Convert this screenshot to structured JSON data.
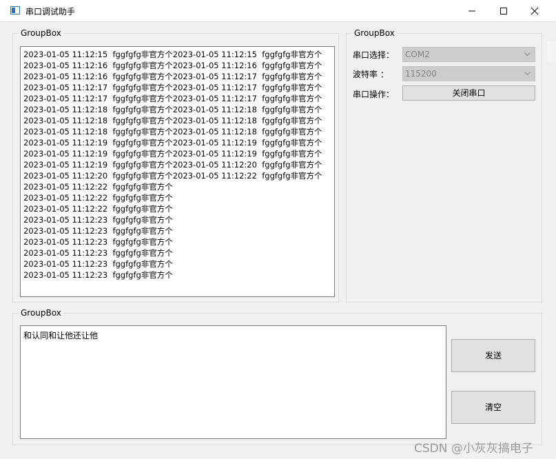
{
  "window": {
    "title": "串口调试助手"
  },
  "log_group": {
    "title": "GroupBox",
    "lines": [
      "2023-01-05 11:12:15  fggfgfg非官方个2023-01-05 11:12:15  fggfgfg非官方个",
      "2023-01-05 11:12:16  fggfgfg非官方个2023-01-05 11:12:16  fggfgfg非官方个",
      "2023-01-05 11:12:16  fggfgfg非官方个2023-01-05 11:12:17  fggfgfg非官方个",
      "2023-01-05 11:12:17  fggfgfg非官方个2023-01-05 11:12:17  fggfgfg非官方个",
      "2023-01-05 11:12:17  fggfgfg非官方个2023-01-05 11:12:17  fggfgfg非官方个",
      "2023-01-05 11:12:18  fggfgfg非官方个2023-01-05 11:12:18  fggfgfg非官方个",
      "2023-01-05 11:12:18  fggfgfg非官方个2023-01-05 11:12:18  fggfgfg非官方个",
      "2023-01-05 11:12:18  fggfgfg非官方个2023-01-05 11:12:18  fggfgfg非官方个",
      "2023-01-05 11:12:19  fggfgfg非官方个2023-01-05 11:12:19  fggfgfg非官方个",
      "2023-01-05 11:12:19  fggfgfg非官方个2023-01-05 11:12:19  fggfgfg非官方个",
      "2023-01-05 11:12:19  fggfgfg非官方个2023-01-05 11:12:20  fggfgfg非官方个",
      "2023-01-05 11:12:20  fggfgfg非官方个2023-01-05 11:12:22  fggfgfg非官方个",
      "2023-01-05 11:12:22  fggfgfg非官方个",
      "2023-01-05 11:12:22  fggfgfg非官方个",
      "2023-01-05 11:12:22  fggfgfg非官方个",
      "2023-01-05 11:12:23  fggfgfg非官方个",
      "2023-01-05 11:12:23  fggfgfg非官方个",
      "2023-01-05 11:12:23  fggfgfg非官方个",
      "2023-01-05 11:12:23  fggfgfg非官方个",
      "2023-01-05 11:12:23  fggfgfg非官方个",
      "2023-01-05 11:12:23  fggfgfg非官方个"
    ]
  },
  "serial_group": {
    "title": "GroupBox",
    "port_label": "串口选择：",
    "port_value": "COM2",
    "baud_label": "波特率 ：",
    "baud_value": "115200",
    "op_label": "串口操作：",
    "close_button": "关闭串口"
  },
  "send_group": {
    "title": "GroupBox",
    "input_value": "和认同和让他还让他",
    "send_button": "发送",
    "clear_button": "清空"
  },
  "watermark": "CSDN @小灰灰搞电子"
}
